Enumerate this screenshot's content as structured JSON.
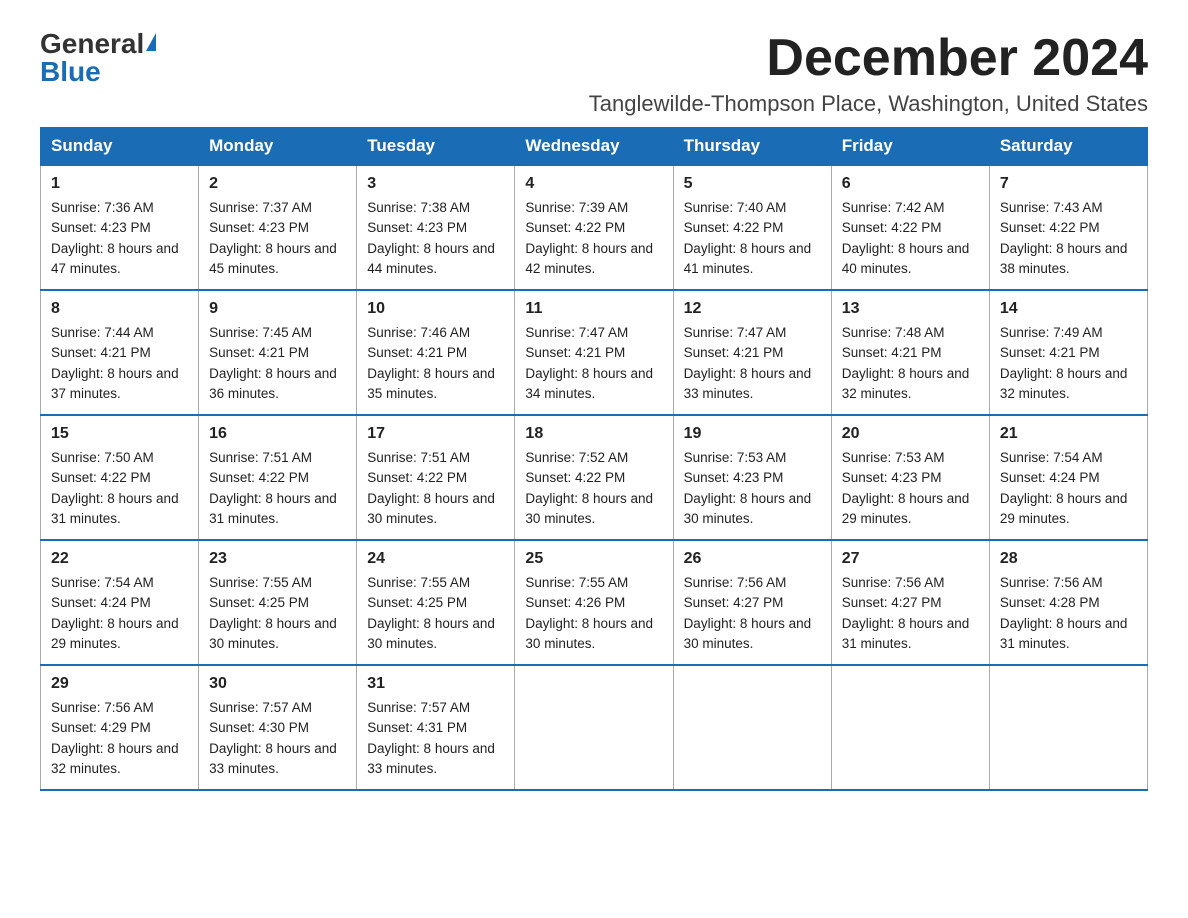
{
  "logo": {
    "general": "General",
    "blue": "Blue"
  },
  "title": "December 2024",
  "location": "Tanglewilde-Thompson Place, Washington, United States",
  "headers": [
    "Sunday",
    "Monday",
    "Tuesday",
    "Wednesday",
    "Thursday",
    "Friday",
    "Saturday"
  ],
  "weeks": [
    [
      {
        "day": "1",
        "sunrise": "7:36 AM",
        "sunset": "4:23 PM",
        "daylight": "8 hours and 47 minutes."
      },
      {
        "day": "2",
        "sunrise": "7:37 AM",
        "sunset": "4:23 PM",
        "daylight": "8 hours and 45 minutes."
      },
      {
        "day": "3",
        "sunrise": "7:38 AM",
        "sunset": "4:23 PM",
        "daylight": "8 hours and 44 minutes."
      },
      {
        "day": "4",
        "sunrise": "7:39 AM",
        "sunset": "4:22 PM",
        "daylight": "8 hours and 42 minutes."
      },
      {
        "day": "5",
        "sunrise": "7:40 AM",
        "sunset": "4:22 PM",
        "daylight": "8 hours and 41 minutes."
      },
      {
        "day": "6",
        "sunrise": "7:42 AM",
        "sunset": "4:22 PM",
        "daylight": "8 hours and 40 minutes."
      },
      {
        "day": "7",
        "sunrise": "7:43 AM",
        "sunset": "4:22 PM",
        "daylight": "8 hours and 38 minutes."
      }
    ],
    [
      {
        "day": "8",
        "sunrise": "7:44 AM",
        "sunset": "4:21 PM",
        "daylight": "8 hours and 37 minutes."
      },
      {
        "day": "9",
        "sunrise": "7:45 AM",
        "sunset": "4:21 PM",
        "daylight": "8 hours and 36 minutes."
      },
      {
        "day": "10",
        "sunrise": "7:46 AM",
        "sunset": "4:21 PM",
        "daylight": "8 hours and 35 minutes."
      },
      {
        "day": "11",
        "sunrise": "7:47 AM",
        "sunset": "4:21 PM",
        "daylight": "8 hours and 34 minutes."
      },
      {
        "day": "12",
        "sunrise": "7:47 AM",
        "sunset": "4:21 PM",
        "daylight": "8 hours and 33 minutes."
      },
      {
        "day": "13",
        "sunrise": "7:48 AM",
        "sunset": "4:21 PM",
        "daylight": "8 hours and 32 minutes."
      },
      {
        "day": "14",
        "sunrise": "7:49 AM",
        "sunset": "4:21 PM",
        "daylight": "8 hours and 32 minutes."
      }
    ],
    [
      {
        "day": "15",
        "sunrise": "7:50 AM",
        "sunset": "4:22 PM",
        "daylight": "8 hours and 31 minutes."
      },
      {
        "day": "16",
        "sunrise": "7:51 AM",
        "sunset": "4:22 PM",
        "daylight": "8 hours and 31 minutes."
      },
      {
        "day": "17",
        "sunrise": "7:51 AM",
        "sunset": "4:22 PM",
        "daylight": "8 hours and 30 minutes."
      },
      {
        "day": "18",
        "sunrise": "7:52 AM",
        "sunset": "4:22 PM",
        "daylight": "8 hours and 30 minutes."
      },
      {
        "day": "19",
        "sunrise": "7:53 AM",
        "sunset": "4:23 PM",
        "daylight": "8 hours and 30 minutes."
      },
      {
        "day": "20",
        "sunrise": "7:53 AM",
        "sunset": "4:23 PM",
        "daylight": "8 hours and 29 minutes."
      },
      {
        "day": "21",
        "sunrise": "7:54 AM",
        "sunset": "4:24 PM",
        "daylight": "8 hours and 29 minutes."
      }
    ],
    [
      {
        "day": "22",
        "sunrise": "7:54 AM",
        "sunset": "4:24 PM",
        "daylight": "8 hours and 29 minutes."
      },
      {
        "day": "23",
        "sunrise": "7:55 AM",
        "sunset": "4:25 PM",
        "daylight": "8 hours and 30 minutes."
      },
      {
        "day": "24",
        "sunrise": "7:55 AM",
        "sunset": "4:25 PM",
        "daylight": "8 hours and 30 minutes."
      },
      {
        "day": "25",
        "sunrise": "7:55 AM",
        "sunset": "4:26 PM",
        "daylight": "8 hours and 30 minutes."
      },
      {
        "day": "26",
        "sunrise": "7:56 AM",
        "sunset": "4:27 PM",
        "daylight": "8 hours and 30 minutes."
      },
      {
        "day": "27",
        "sunrise": "7:56 AM",
        "sunset": "4:27 PM",
        "daylight": "8 hours and 31 minutes."
      },
      {
        "day": "28",
        "sunrise": "7:56 AM",
        "sunset": "4:28 PM",
        "daylight": "8 hours and 31 minutes."
      }
    ],
    [
      {
        "day": "29",
        "sunrise": "7:56 AM",
        "sunset": "4:29 PM",
        "daylight": "8 hours and 32 minutes."
      },
      {
        "day": "30",
        "sunrise": "7:57 AM",
        "sunset": "4:30 PM",
        "daylight": "8 hours and 33 minutes."
      },
      {
        "day": "31",
        "sunrise": "7:57 AM",
        "sunset": "4:31 PM",
        "daylight": "8 hours and 33 minutes."
      },
      null,
      null,
      null,
      null
    ]
  ]
}
